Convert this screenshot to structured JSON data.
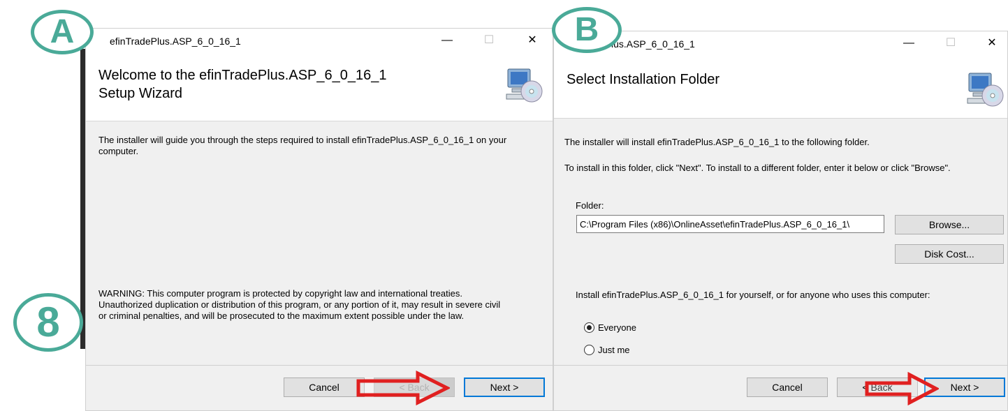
{
  "markers": {
    "a": "A",
    "b": "B",
    "step": "8"
  },
  "window_a": {
    "title": "efinTradePlus.ASP_6_0_16_1",
    "minimize": "—",
    "maximize": "☐",
    "close": "✕",
    "heading_line1": "Welcome to the efinTradePlus.ASP_6_0_16_1",
    "heading_line2": "Setup Wizard",
    "intro_line1": "The installer will guide you through the steps required to install efinTradePlus.ASP_6_0_16_1 on your",
    "intro_line2": "computer.",
    "warning_line1": "WARNING: This computer program is protected by copyright law and international treaties.",
    "warning_line2": "Unauthorized duplication or distribution of this program, or any portion of it, may result in severe civil",
    "warning_line3": "or criminal penalties, and will be prosecuted to the maximum extent possible under the law.",
    "cancel_label": "Cancel",
    "back_label": "< Back",
    "next_label": "Next >"
  },
  "window_b": {
    "title": "efinTradePlus.ASP_6_0_16_1",
    "minimize": "—",
    "maximize": "☐",
    "close": "✕",
    "heading": "Select Installation Folder",
    "line1": "The installer will install efinTradePlus.ASP_6_0_16_1 to the following folder.",
    "line2": "To install in this folder, click \"Next\". To install to a different folder, enter it below or click \"Browse\".",
    "folder_label": "Folder:",
    "folder_value": "C:\\Program Files (x86)\\OnlineAsset\\efinTradePlus.ASP_6_0_16_1\\",
    "browse_label": "Browse...",
    "diskcost_label": "Disk Cost...",
    "install_for": "Install efinTradePlus.ASP_6_0_16_1 for yourself, or for anyone who uses this computer:",
    "options": [
      {
        "label": "Everyone",
        "selected": true
      },
      {
        "label": "Just me",
        "selected": false
      }
    ],
    "cancel_label": "Cancel",
    "back_label": "< Back",
    "next_label": "Next >"
  },
  "colors": {
    "marker": "#4aaa98",
    "arrow": "#e02020",
    "focus_border": "#0078d7"
  }
}
